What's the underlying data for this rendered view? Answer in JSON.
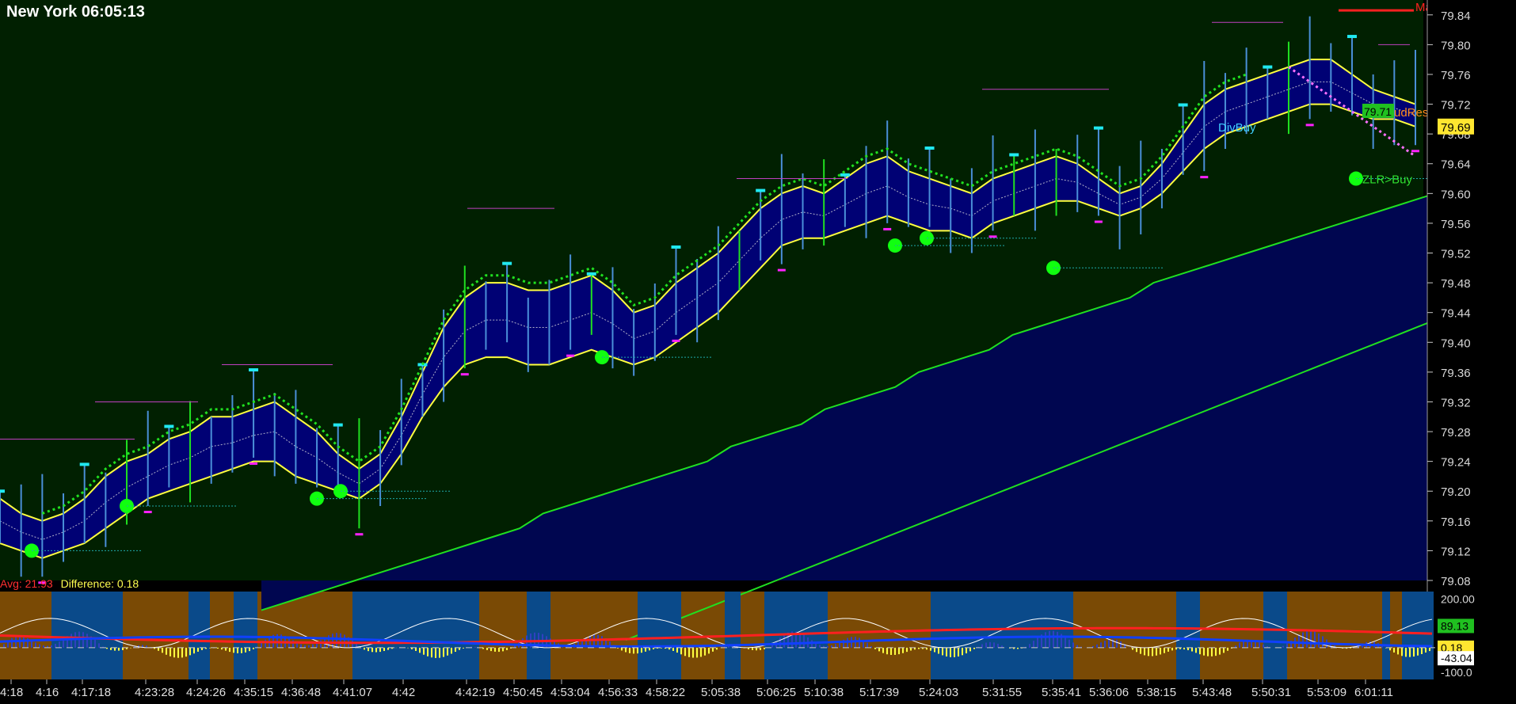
{
  "header": {
    "title": "New York 06:05:13"
  },
  "indicator": {
    "avg_text": "Avg: 21.93",
    "diff_text": "Difference: 0.18"
  },
  "colors": {
    "background": "#000000",
    "price_panel": "#012001",
    "candle": "#4a8fd8",
    "band_fill": "#00007a",
    "band_line": "#ffff40",
    "lower_band": "#000650",
    "green_line": "#20e020",
    "buy_dot": "#10ff10",
    "cyan_marker": "#20e8f0",
    "magenta_marker": "#ff20ff",
    "osc_orange": "#7a4a05",
    "osc_blue": "#0a4a8a"
  },
  "chart_data": {
    "type": "line",
    "title": "New York 06:05:13",
    "ylim": [
      79.08,
      79.86
    ],
    "y_ticks": [
      79.84,
      79.8,
      79.76,
      79.72,
      79.68,
      79.64,
      79.6,
      79.56,
      79.52,
      79.48,
      79.44,
      79.4,
      79.36,
      79.32,
      79.28,
      79.24,
      79.2,
      79.16,
      79.12,
      79.08
    ],
    "x_tick_labels": [
      "4:18",
      "4:16",
      "4:17:18",
      "4:23:28",
      "4:24:26",
      "4:35:15",
      "4:36:48",
      "4:41:07",
      "4:42",
      "4:42:19",
      "4:50:45",
      "4:53:04",
      "4:56:33",
      "4:58:22",
      "5:05:38",
      "5:06:25",
      "5:10:38",
      "5:17:39",
      "5:24:03",
      "5:31:55",
      "5:35:41",
      "5:36:06",
      "5:38:15",
      "5:43:48",
      "5:50:31",
      "5:53:09",
      "6:01:11"
    ],
    "price_labels": [
      {
        "text": "79.69",
        "value": 79.69
      },
      {
        "text": "79.71",
        "value": 79.71
      }
    ],
    "annotations": [
      {
        "text": "MainHigh",
        "value": 79.85
      },
      {
        "text": "udResistance",
        "value": 79.71
      },
      {
        "text": "DivBuy",
        "value": 79.69
      },
      {
        "text": "ZLR>Buy",
        "value": 79.62
      }
    ],
    "series": [
      {
        "values": [
          79.19,
          79.17,
          79.16,
          79.17,
          79.19,
          79.22,
          79.24,
          79.25,
          79.27,
          79.28,
          79.3,
          79.3,
          79.31,
          79.32,
          79.3,
          79.28,
          79.25,
          79.23,
          79.25,
          79.3,
          79.36,
          79.42,
          79.46,
          79.48,
          79.48,
          79.47,
          79.47,
          79.48,
          79.49,
          79.47,
          79.44,
          79.45,
          79.48,
          79.5,
          79.52,
          79.55,
          79.58,
          79.6,
          79.61,
          79.6,
          79.62,
          79.64,
          79.65,
          79.63,
          79.62,
          79.61,
          79.6,
          79.62,
          79.63,
          79.64,
          79.65,
          79.64,
          79.62,
          79.6,
          79.61,
          79.64,
          79.68,
          79.72,
          79.74,
          79.75,
          79.76,
          79.77,
          79.78,
          79.78,
          79.76,
          79.74,
          79.73,
          79.72
        ]
      },
      {
        "values": [
          79.13,
          79.12,
          79.11,
          79.12,
          79.13,
          79.15,
          79.17,
          79.19,
          79.2,
          79.21,
          79.22,
          79.23,
          79.24,
          79.24,
          79.22,
          79.21,
          79.2,
          79.19,
          79.21,
          79.25,
          79.3,
          79.34,
          79.37,
          79.38,
          79.38,
          79.37,
          79.37,
          79.38,
          79.39,
          79.38,
          79.37,
          79.38,
          79.4,
          79.42,
          79.44,
          79.47,
          79.5,
          79.53,
          79.54,
          79.54,
          79.55,
          79.56,
          79.57,
          79.56,
          79.55,
          79.55,
          79.54,
          79.56,
          79.57,
          79.58,
          79.59,
          79.59,
          79.58,
          79.57,
          79.58,
          79.6,
          79.63,
          79.66,
          79.68,
          79.69,
          79.7,
          79.71,
          79.72,
          79.72,
          79.71,
          79.7,
          79.7,
          79.69
        ]
      },
      {
        "values": [
          79.04,
          79.05,
          79.06,
          79.07,
          79.08,
          79.09,
          79.1,
          79.11,
          79.12,
          79.13,
          79.14,
          79.15,
          79.17,
          79.18,
          79.19,
          79.2,
          79.21,
          79.22,
          79.23,
          79.24,
          79.26,
          79.27,
          79.28,
          79.29,
          79.31,
          79.32,
          79.33,
          79.34,
          79.36,
          79.37,
          79.38,
          79.39,
          79.41,
          79.42,
          79.43,
          79.44,
          79.45,
          79.46,
          79.48,
          79.49,
          79.5,
          79.51,
          79.52,
          79.53,
          79.54,
          79.55,
          79.56,
          79.57,
          79.58,
          79.59,
          79.6
        ]
      },
      {
        "values": [
          79.0,
          79.01,
          79.02,
          79.03,
          79.04,
          79.05,
          79.06,
          79.07,
          79.08,
          79.09,
          79.1,
          79.11,
          79.12,
          79.13,
          79.14,
          79.15,
          79.16,
          79.17,
          79.18,
          79.19,
          79.2,
          79.21,
          79.22,
          79.23,
          79.24,
          79.25,
          79.26,
          79.27,
          79.28,
          79.29,
          79.3,
          79.31,
          79.32,
          79.33,
          79.34,
          79.35,
          79.36,
          79.37,
          79.38,
          79.39,
          79.4,
          79.41,
          79.42,
          79.43
        ]
      }
    ],
    "buy_signals": [
      79.12,
      79.18,
      79.19,
      79.2,
      79.38,
      79.53,
      79.54,
      79.5,
      79.62
    ],
    "oscillator": {
      "ylim": [
        -130,
        230
      ],
      "y_ticks": [
        200.0,
        89.13,
        0.18,
        -43.04,
        -100.0
      ],
      "y_tick_labels": [
        "200.00",
        "89.13",
        "0.18",
        "-43.04",
        "-100.0"
      ]
    },
    "grid": false,
    "legend": "none"
  }
}
